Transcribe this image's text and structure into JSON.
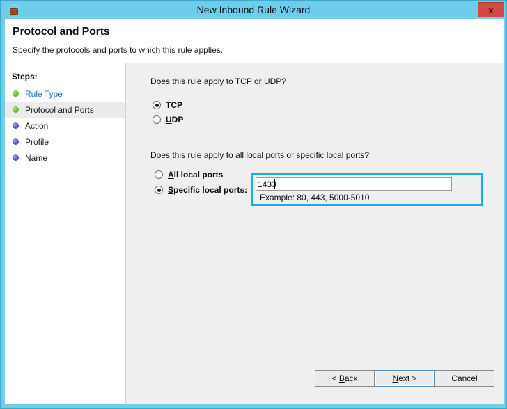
{
  "window": {
    "title": "New Inbound Rule Wizard",
    "icon": "firewall-shield-icon",
    "close_label": "x",
    "titlebar_color": "#6ecdec"
  },
  "header": {
    "title": "Protocol and Ports",
    "subtitle": "Specify the protocols and ports to which this rule applies."
  },
  "sidebar": {
    "steps_label": "Steps:",
    "items": [
      {
        "label": "Rule Type",
        "bullet": "green",
        "state": "completed"
      },
      {
        "label": "Protocol and Ports",
        "bullet": "green",
        "state": "current"
      },
      {
        "label": "Action",
        "bullet": "blue",
        "state": "pending"
      },
      {
        "label": "Profile",
        "bullet": "blue",
        "state": "pending"
      },
      {
        "label": "Name",
        "bullet": "blue",
        "state": "pending"
      }
    ]
  },
  "main": {
    "question_protocol": "Does this rule apply to TCP or UDP?",
    "protocol_options": [
      {
        "label": "TCP",
        "accel": "T",
        "rest": "CP",
        "checked": true
      },
      {
        "label": "UDP",
        "accel": "U",
        "rest": "DP",
        "checked": false
      }
    ],
    "question_ports": "Does this rule apply to all local ports or specific local ports?",
    "port_options": [
      {
        "label": "All local ports",
        "accel": "A",
        "rest": "ll local ports",
        "checked": false
      },
      {
        "label": "Specific local ports:",
        "accel": "S",
        "rest": "pecific local ports:",
        "checked": true
      }
    ],
    "port_input_value": "1433",
    "port_input_placeholder": "",
    "example_text": "Example: 80, 443, 5000-5010",
    "highlight_color": "#16b0e4"
  },
  "buttons": {
    "back": {
      "prefix": "< ",
      "accel": "B",
      "rest": "ack",
      "suffix": ""
    },
    "next": {
      "prefix": "",
      "accel": "N",
      "rest": "ext",
      "suffix": " >"
    },
    "cancel": {
      "label": "Cancel"
    }
  }
}
